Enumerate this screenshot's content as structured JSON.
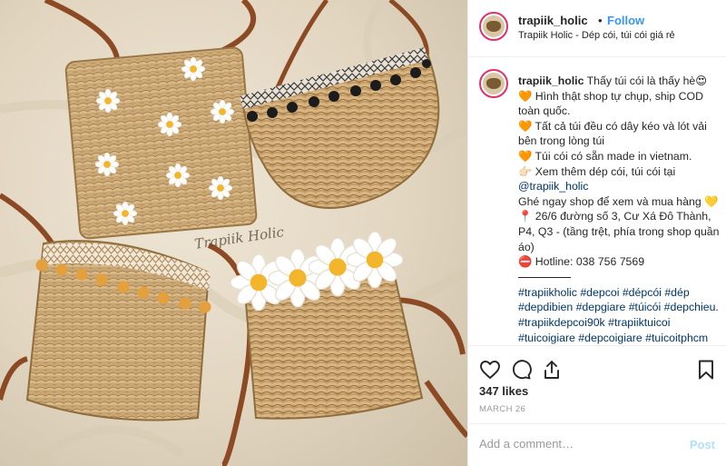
{
  "photo": {
    "alt": "Four woven water-hyacinth bags with daisies and pom-pom trims",
    "watermark": "Trapiik Holic"
  },
  "header": {
    "username": "trapiik_holic",
    "dot": "•",
    "follow_label": "Follow",
    "subtitle": "Trapiik Holic - Dép cói, túi cói giá rẻ"
  },
  "caption": {
    "username": "trapiik_holic",
    "intro": "Thấy túi cói là thấy hè😍",
    "lines": [
      "🧡 Hình thật shop tự chụp, ship COD toàn quốc.",
      "🧡 Tất cả túi đều có dây kéo và lót vải bên trong lòng túi",
      "🧡 Túi cói có sẵn made in vietnam.",
      "👉🏻 Xem thêm dép cói, túi cói tại"
    ],
    "mention": "@trapiik_holic",
    "call_to_action": "Ghé ngay shop để xem và mua hàng 💛",
    "address": "📍 26/6 đường số 3, Cư Xá Đô Thành, P4, Q3 - (tầng trệt, phía trong shop quần áo)",
    "hotline": "⛔ Hotline: 038 756 7569",
    "hashtags": "#trapiikholic #depcoi #dépcói #dép #depdibien #depgiare #túicói #depchieu. #trapiikdepcoi90k #trapiiktuicoi #tuicoigiare #depcoigiare #tuicoitphcm #depcoitphcm #tuicoi"
  },
  "actions": {
    "like_icon": "heart-icon",
    "comment_icon": "comment-icon",
    "share_icon": "share-icon",
    "save_icon": "bookmark-icon"
  },
  "likes": "347 likes",
  "date": "MARCH 26",
  "comment": {
    "placeholder": "Add a comment…",
    "post_label": "Post"
  },
  "colors": {
    "link_blue": "#3897f0",
    "post_disabled": "#b2dffc",
    "hashtag": "#003569",
    "story_ring": "#e1306c",
    "wicker": "#c9a470"
  }
}
